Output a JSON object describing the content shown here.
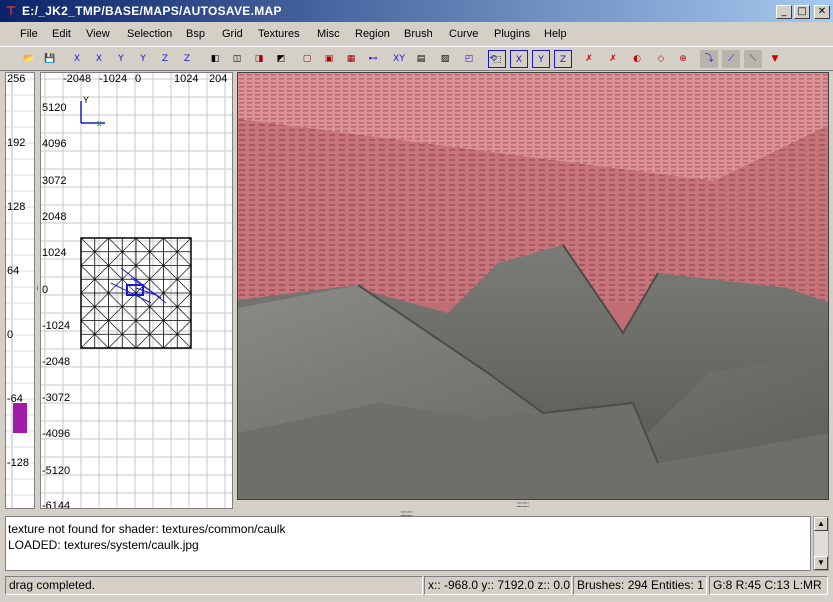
{
  "window": {
    "title": "E:/_JK2_TMP/BASE/MAPS/AUTOSAVE.MAP",
    "minimize": "_",
    "maximize": "□",
    "close": "✕"
  },
  "menu": [
    "File",
    "Edit",
    "View",
    "Selection",
    "Bsp",
    "Grid",
    "Textures",
    "Misc",
    "Region",
    "Brush",
    "Curve",
    "Plugins",
    "Help"
  ],
  "toolbar": [
    {
      "name": "open-icon",
      "glyph": "📂"
    },
    {
      "name": "save-icon",
      "glyph": "💾"
    },
    {
      "name": "flip-x-icon",
      "glyph": "X"
    },
    {
      "name": "rotate-x-icon",
      "glyph": "X"
    },
    {
      "name": "flip-y-icon",
      "glyph": "Y"
    },
    {
      "name": "rotate-y-icon",
      "glyph": "Y"
    },
    {
      "name": "flip-z-icon",
      "glyph": "Z"
    },
    {
      "name": "rotate-z-icon",
      "glyph": "Z"
    },
    {
      "name": "clipper-icon",
      "glyph": "◧"
    },
    {
      "name": "make-hollow-icon",
      "glyph": "◫"
    },
    {
      "name": "csg-subtract-icon",
      "glyph": "◨"
    },
    {
      "name": "csg-merge-icon",
      "glyph": "◩"
    },
    {
      "name": "select-inside-icon",
      "glyph": "▢"
    },
    {
      "name": "select-touching-icon",
      "glyph": "▣"
    },
    {
      "name": "select-partial-icon",
      "glyph": "▦"
    },
    {
      "name": "entity-icon",
      "glyph": "⊷"
    },
    {
      "name": "view-change-icon",
      "glyph": "XY"
    },
    {
      "name": "texture-view-icon",
      "glyph": "▤"
    },
    {
      "name": "camera-icon",
      "glyph": "▨"
    },
    {
      "name": "cubic-clip-icon",
      "glyph": "◰"
    },
    {
      "name": "rotate-view-icon",
      "glyph": "⟲"
    },
    {
      "name": "change-view-icon",
      "glyph": "⬚"
    },
    {
      "name": "view-x-icon",
      "glyph": "X"
    },
    {
      "name": "view-y-icon",
      "glyph": "Y"
    },
    {
      "name": "view-z-icon",
      "glyph": "Z"
    },
    {
      "name": "hide-patch-icon",
      "glyph": "✗"
    },
    {
      "name": "hide-curve-icon",
      "glyph": "✗"
    },
    {
      "name": "patch-bend-icon",
      "glyph": "◐"
    },
    {
      "name": "patch-insdel-icon",
      "glyph": "◇"
    },
    {
      "name": "patch-weld-icon",
      "glyph": "⊕"
    },
    {
      "name": "drill-down-icon",
      "glyph": "⤵"
    },
    {
      "name": "show-bound-icon",
      "glyph": "⟋"
    },
    {
      "name": "scale-lock-icon",
      "glyph": "⟍"
    },
    {
      "name": "select-mode-icon",
      "glyph": "▼"
    }
  ],
  "zview": {
    "labels": [
      "256",
      "192",
      "128",
      "64",
      "0",
      "-64",
      "-128"
    ]
  },
  "xyview": {
    "top_labels": [
      "-2048",
      "-1024",
      "0",
      "1024",
      "204"
    ],
    "left_labels": [
      "5120",
      "4096",
      "3072",
      "2048",
      "1024",
      "0",
      "-1024",
      "-2048",
      "-3072",
      "-4096",
      "-5120",
      "-6144"
    ],
    "axis_x": "x",
    "axis_y": "Y"
  },
  "console": {
    "lines": [
      "texture not found for shader: textures/common/caulk",
      "LOADED: textures/system/caulk.jpg"
    ]
  },
  "status": {
    "message": "drag completed.",
    "coords": "x:: -968.0  y:: 7192.0  z:: 0.0",
    "counts": "Brushes: 294 Entities: 1",
    "grid": "G:8 R:45 C:13 L:MR"
  },
  "colors": {
    "title_bg": "#0a246a",
    "ceiling": "#d6878c",
    "wall": "#c06e74",
    "rock": "#6a6a68",
    "z_marker": "#a21aa8",
    "brush_selected": "#1a1acc"
  }
}
